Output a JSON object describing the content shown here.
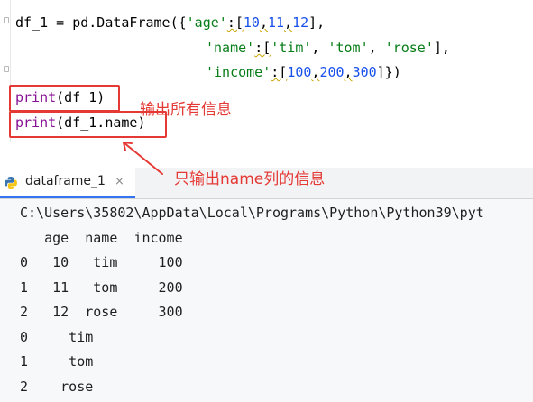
{
  "editor": {
    "line1": {
      "lhs": "df_1 = pd.DataFrame({",
      "key": "'age'",
      "colon": ":[",
      "v1": "10",
      "c1": ",",
      "v2": "11",
      "c2": ",",
      "v3": "12",
      "end": "],"
    },
    "line2": {
      "key": "'name'",
      "colon": ":[",
      "s1": "'tim'",
      "c1": ", ",
      "s2": "'tom'",
      "c2": ", ",
      "s3": "'rose'",
      "end": "],"
    },
    "line3": {
      "key": "'income'",
      "colon": ":[",
      "v1": "100",
      "c1": ",",
      "v2": "200",
      "c2": ",",
      "v3": "300",
      "end": "]})"
    },
    "print1": {
      "fn": "print",
      "args": "(df_1)"
    },
    "print2": {
      "fn": "print",
      "args": "(df_1.name)"
    }
  },
  "annotations": {
    "note1": "输出所有信息",
    "note2": "只输出name列的信息"
  },
  "tab": {
    "label": "dataframe_1",
    "close": "×",
    "icon": "python-icon"
  },
  "console": {
    "path": "C:\\Users\\35802\\AppData\\Local\\Programs\\Python\\Python39\\pyt",
    "header": "   age  name  income",
    "rows": [
      "0   10   tim     100",
      "1   11   tom     200",
      "2   12  rose     300",
      "0     tim",
      "1     tom",
      "2    rose"
    ]
  },
  "colors": {
    "annotation": "#e53935",
    "tab_accent": "#3574f0"
  }
}
